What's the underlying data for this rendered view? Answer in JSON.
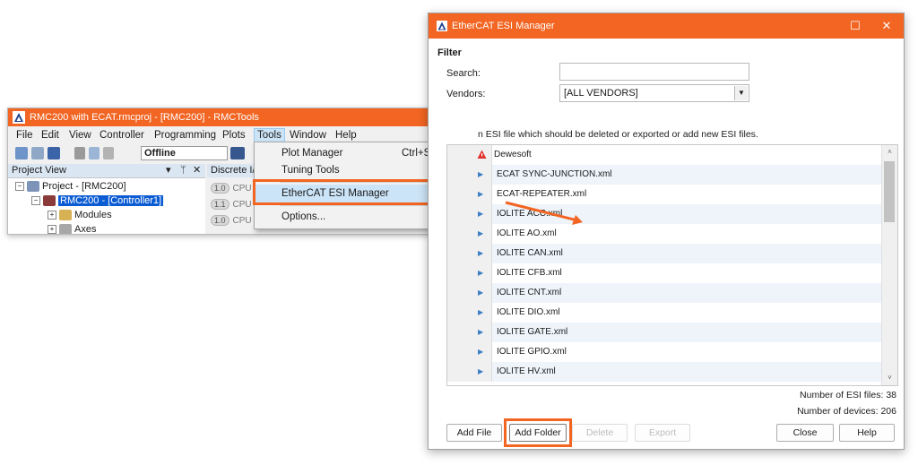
{
  "colors": {
    "accent": "#f26522",
    "selection": "#cce4f7",
    "tree_selection": "#0b5bd3"
  },
  "rmctools": {
    "title": "RMC200 with ECAT.rmcproj - [RMC200] - RMCTools",
    "menu": [
      "File",
      "Edit",
      "View",
      "Controller",
      "Programming",
      "Plots",
      "Tools",
      "Window",
      "Help"
    ],
    "toolbar": {
      "mode_value": "Offline"
    },
    "project_view": {
      "header": "Project View",
      "header_buttons": [
        "▾",
        "ᛘ",
        "✕"
      ],
      "tree": [
        {
          "label": "Project - [RMC200]",
          "expander": "−",
          "icon": "project-icon"
        },
        {
          "label": "RMC200 - [Controller1]",
          "expander": "−",
          "icon": "controller-icon",
          "selected": true
        },
        {
          "label": "Modules",
          "expander": "+",
          "icon": "folder-icon"
        },
        {
          "label": "Axes",
          "expander": "+",
          "icon": "axes-icon"
        }
      ]
    },
    "discrete_panel": {
      "header": "Discrete I/",
      "rows": [
        {
          "pill": "1.0",
          "text": "CPU"
        },
        {
          "pill": "1.1",
          "text": "CPU"
        },
        {
          "pill": "1.0",
          "text": "CPU"
        }
      ]
    }
  },
  "tools_menu": {
    "items": [
      {
        "label": "Plot Manager",
        "shortcut": "Ctrl+Shift+P"
      },
      {
        "label": "Tuning Tools",
        "shortcut": ""
      },
      {
        "label": "EtherCAT ESI Manager",
        "shortcut": "",
        "highlighted": true
      },
      {
        "label": "Options...",
        "shortcut": ""
      }
    ]
  },
  "esi_manager": {
    "title": "EtherCAT ESI Manager",
    "window_buttons": {
      "maximize": "☐",
      "close": "✕"
    },
    "filter_label": "Filter",
    "search_label": "Search:",
    "search_value": "",
    "vendors_label": "Vendors:",
    "vendors_value": "[ALL VENDORS]",
    "instruction": "n ESI file which should be deleted or exported or add new ESI files.",
    "vendor_row": "Dewesoft",
    "files": [
      "ECAT SYNC-JUNCTION.xml",
      "ECAT-REPEATER.xml",
      "IOLITE ACC.xml",
      "IOLITE AO.xml",
      "IOLITE CAN.xml",
      "IOLITE CFB.xml",
      "IOLITE CNT.xml",
      "IOLITE DIO.xml",
      "IOLITE GATE.xml",
      "IOLITE GPIO.xml",
      "IOLITE HV.xml"
    ],
    "scroll_up": "˄",
    "scroll_down": "˅",
    "num_esi_files": "Number of ESI files: 38",
    "num_devices": "Number of devices: 206",
    "buttons": {
      "add_file": "Add File",
      "add_folder": "Add Folder",
      "delete": "Delete",
      "export": "Export",
      "close": "Close",
      "help": "Help"
    }
  }
}
